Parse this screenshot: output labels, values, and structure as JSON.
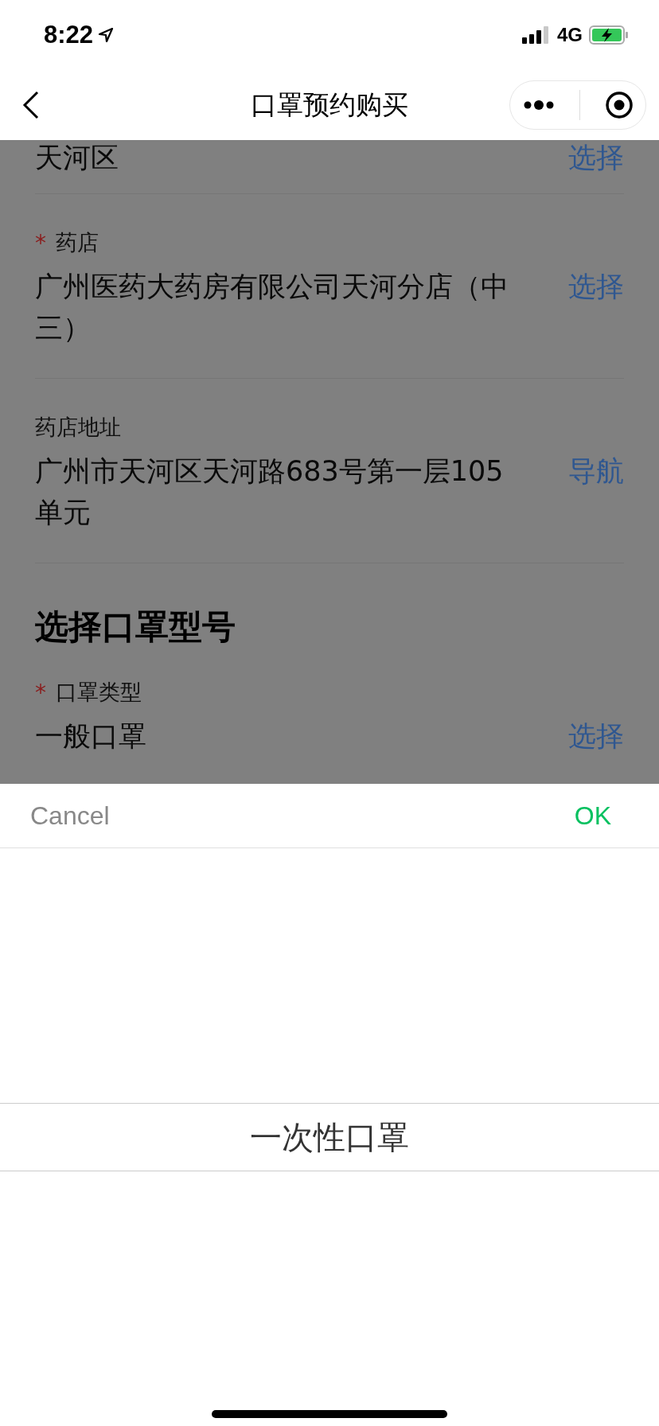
{
  "status_bar": {
    "time": "8:22",
    "network": "4G"
  },
  "nav": {
    "title": "口罩预约购买"
  },
  "sections": [
    {
      "rows": [
        {
          "value": "天河区",
          "action": "选择"
        }
      ]
    },
    {
      "rows": [
        {
          "required_mark": "*",
          "label": "药店",
          "value": "广州医药大药房有限公司天河分店（中三）",
          "action": "选择"
        },
        {
          "label": "药店地址",
          "value": "广州市天河区天河路683号第一层105单元",
          "action": "导航"
        }
      ]
    },
    {
      "title": "选择口罩型号",
      "rows": [
        {
          "required_mark": "*",
          "label": "口罩类型",
          "value": "一般口罩",
          "action": "选择"
        }
      ]
    }
  ],
  "picker": {
    "cancel": "Cancel",
    "ok": "OK",
    "options": [
      {
        "label": "一次性口罩",
        "selected": true
      }
    ]
  }
}
